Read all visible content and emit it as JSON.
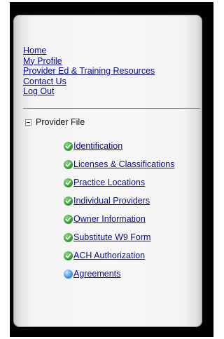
{
  "nav": {
    "links": [
      "Home",
      "My Profile",
      "Provider Ed & Training Resources",
      "Contact Us",
      "Log Out"
    ]
  },
  "tree": {
    "root_label": "Provider File",
    "items": [
      {
        "label": "Identification",
        "status": "complete",
        "icon": "green-checkmark-icon"
      },
      {
        "label": "Licenses & Classifications",
        "status": "complete",
        "icon": "green-checkmark-icon"
      },
      {
        "label": "Practice Locations",
        "status": "complete",
        "icon": "green-checkmark-icon"
      },
      {
        "label": "Individual Providers",
        "status": "complete",
        "icon": "green-checkmark-icon"
      },
      {
        "label": "Owner Information",
        "status": "complete",
        "icon": "green-checkmark-icon"
      },
      {
        "label": "Substitute W9 Form",
        "status": "complete",
        "icon": "green-checkmark-icon"
      },
      {
        "label": "ACH Authorization",
        "status": "complete",
        "icon": "green-checkmark-icon"
      },
      {
        "label": "Agreements",
        "status": "pending",
        "icon": "blue-circle-icon"
      }
    ]
  },
  "colors": {
    "link": "#0a0a9a",
    "frame": "#000000",
    "complete": "#3aa437",
    "pending": "#4d9be6"
  }
}
